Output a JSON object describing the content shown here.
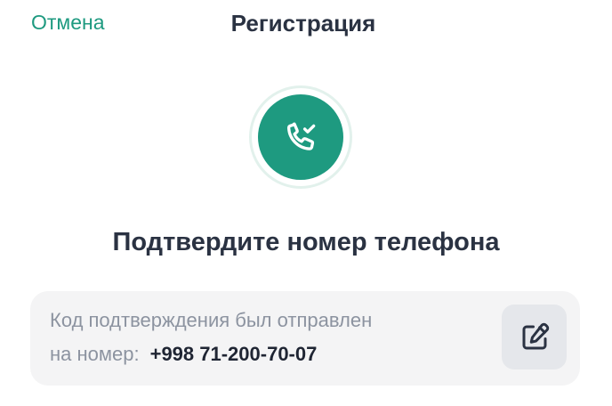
{
  "header": {
    "cancel_label": "Отмена",
    "title": "Регистрация"
  },
  "badge": {
    "icon": "phone-check-icon",
    "color": "#1e9a80"
  },
  "headline": "Подтвердите номер телефона",
  "info": {
    "line1": "Код подтверждения был отправлен",
    "line2_prefix": "на номер:",
    "phone": "+998 71-200-70-07",
    "edit_icon": "edit-icon"
  },
  "colors": {
    "accent": "#1e9a80",
    "text_primary": "#2a3242",
    "text_muted": "#8c93a0",
    "card_bg": "#f4f4f5"
  }
}
